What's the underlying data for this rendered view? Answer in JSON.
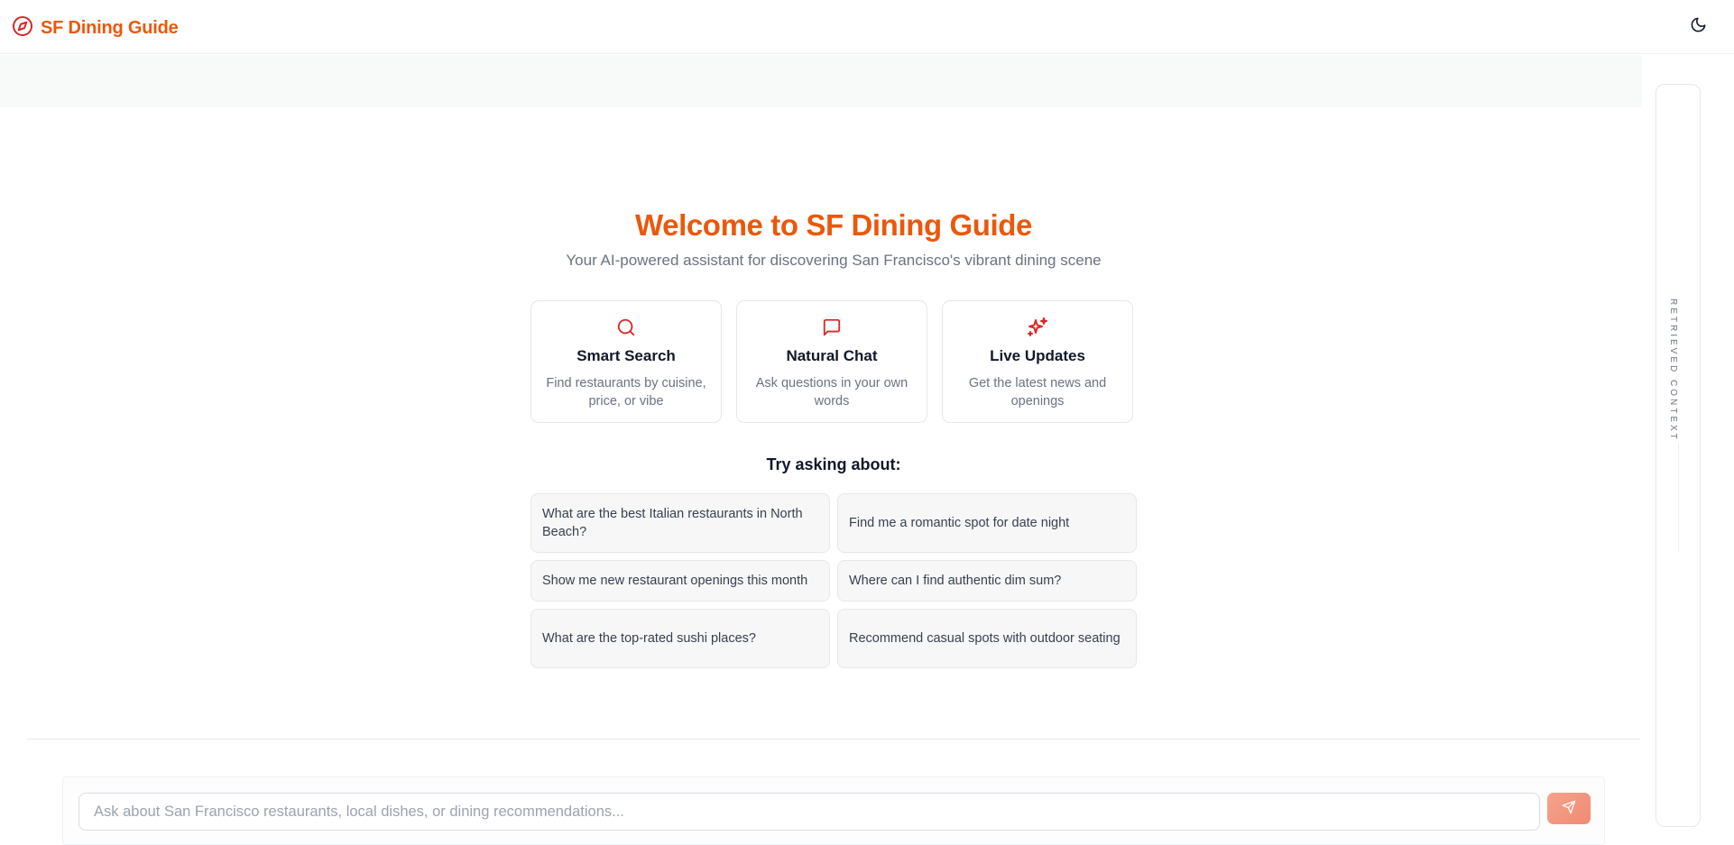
{
  "header": {
    "brand": "SF Dining Guide",
    "brand_icon": "compass-icon",
    "theme_toggle_icon": "moon-icon"
  },
  "hero": {
    "title": "Welcome to SF Dining Guide",
    "subtitle": "Your AI-powered assistant for discovering San Francisco's vibrant dining scene"
  },
  "features": [
    {
      "icon": "search-icon",
      "title": "Smart Search",
      "description": "Find restaurants by cuisine, price, or vibe"
    },
    {
      "icon": "message-square-icon",
      "title": "Natural Chat",
      "description": "Ask questions in your own words"
    },
    {
      "icon": "sparkles-icon",
      "title": "Live Updates",
      "description": "Get the latest news and openings"
    }
  ],
  "suggestions": {
    "title": "Try asking about:",
    "items": [
      "What are the best Italian restaurants in North Beach?",
      "Find me a romantic spot for date night",
      "Show me new restaurant openings this month",
      "Where can I find authentic dim sum?",
      "What are the top-rated sushi places?",
      "Recommend casual spots with outdoor seating"
    ]
  },
  "chat": {
    "placeholder": "Ask about San Francisco restaurants, local dishes, or dining recommendations...",
    "value": "",
    "send_icon": "send-icon"
  },
  "context_panel": {
    "label": "RETRIEVED CONTEXT"
  },
  "colors": {
    "accent": "#ea580c",
    "icon_red": "#dc2626",
    "send_button": "#f4a28c"
  }
}
